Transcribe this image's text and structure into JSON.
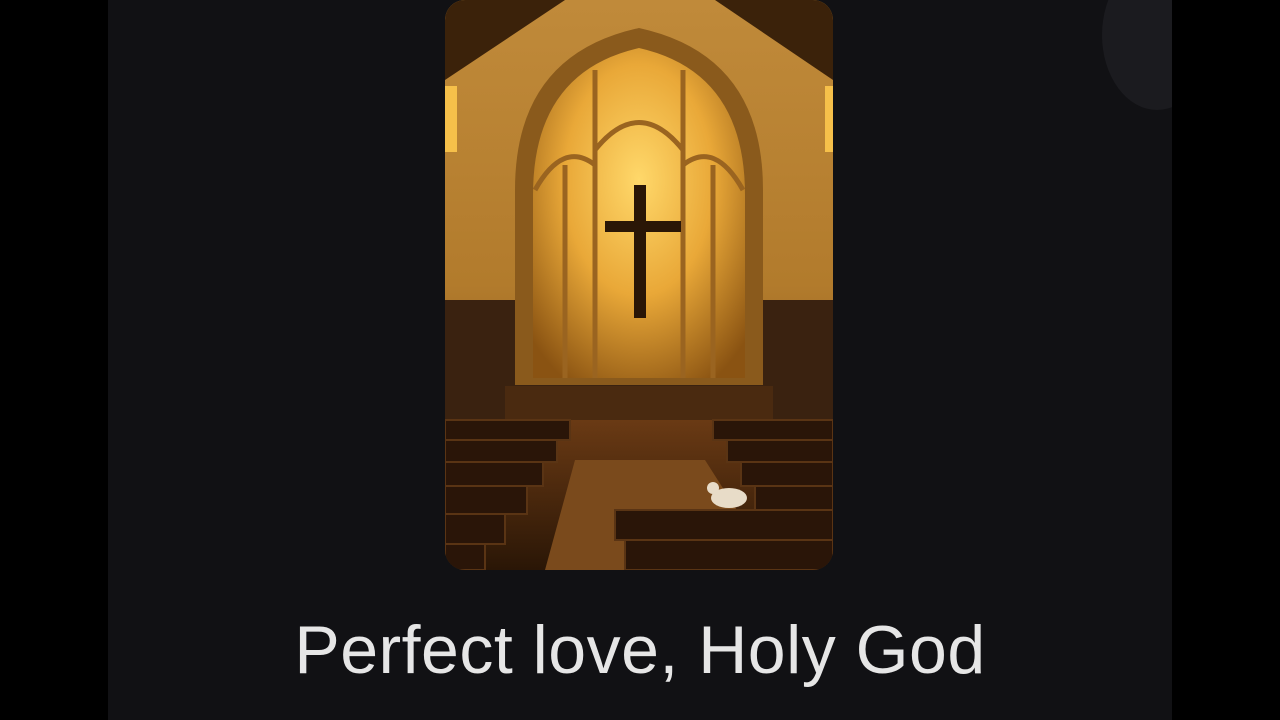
{
  "lyric": {
    "line": "Perfect love, Holy God"
  },
  "artwork": {
    "subject": "church-interior-with-cross"
  },
  "colors": {
    "background": "#111114",
    "letterbox": "#000000",
    "lyric_text": "#e6e6e6",
    "window_glow": "#f3b63a"
  }
}
